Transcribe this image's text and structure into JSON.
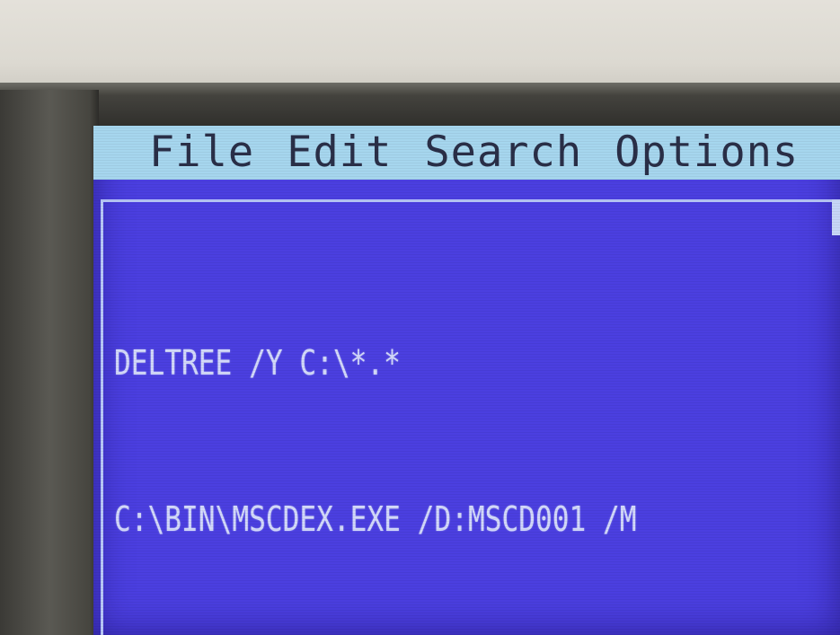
{
  "menubar": {
    "items": [
      {
        "label": "File"
      },
      {
        "label": "Edit"
      },
      {
        "label": "Search"
      },
      {
        "label": "Options"
      }
    ]
  },
  "editor": {
    "lines": [
      "DELTREE /Y C:\\*.*",
      "C:\\BIN\\MSCDEX.EXE /D:MSCD001 /M"
    ]
  },
  "colors": {
    "screen_background": "#4b3fe0",
    "menubar_background": "#a6d6ee",
    "menubar_text": "#2a2f48",
    "editor_text": "#d3d9fa"
  }
}
